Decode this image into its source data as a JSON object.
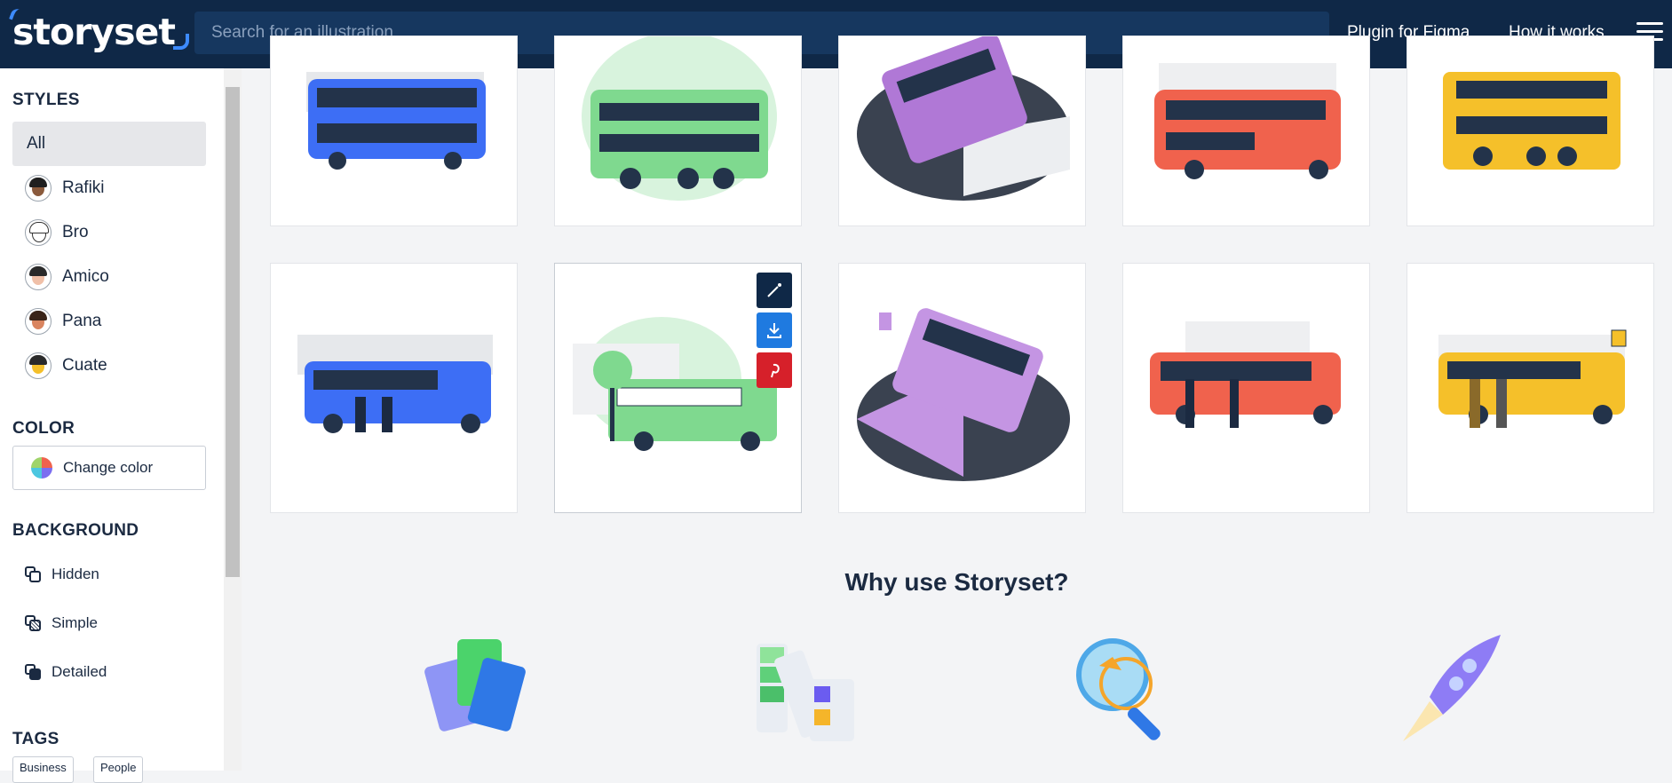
{
  "header": {
    "logo": "storyset",
    "search_placeholder": "Search for an illustration",
    "nav": [
      "Plugin for Figma",
      "How it works"
    ]
  },
  "sidebar": {
    "styles_title": "STYLES",
    "styles": [
      {
        "label": "All",
        "active": true
      },
      {
        "label": "Rafiki"
      },
      {
        "label": "Bro"
      },
      {
        "label": "Amico"
      },
      {
        "label": "Pana"
      },
      {
        "label": "Cuate"
      }
    ],
    "color_title": "COLOR",
    "color_button": "Change color",
    "background_title": "BACKGROUND",
    "backgrounds": [
      "Hidden",
      "Simple",
      "Detailed"
    ],
    "tags_title": "TAGS",
    "tags": [
      "Business",
      "People"
    ]
  },
  "illustrations": {
    "row1": [
      {
        "name": "double-decker-bus-blue",
        "color": "#3d6ef5"
      },
      {
        "name": "double-decker-bus-green",
        "color": "#7fd98f"
      },
      {
        "name": "double-decker-bus-purple",
        "color": "#b078d6"
      },
      {
        "name": "bus-red",
        "color": "#f0624d"
      },
      {
        "name": "double-decker-bus-yellow",
        "color": "#f5c02a"
      }
    ],
    "row2": [
      {
        "name": "school-bus-blue",
        "color": "#3d6ef5"
      },
      {
        "name": "school-bus-green",
        "color": "#7fd98f"
      },
      {
        "name": "school-bus-purple",
        "color": "#c495e3"
      },
      {
        "name": "school-bus-red",
        "color": "#f0624d"
      },
      {
        "name": "school-bus-yellow",
        "color": "#f5c02a"
      }
    ]
  },
  "why": {
    "title": "Why use Storyset?"
  }
}
